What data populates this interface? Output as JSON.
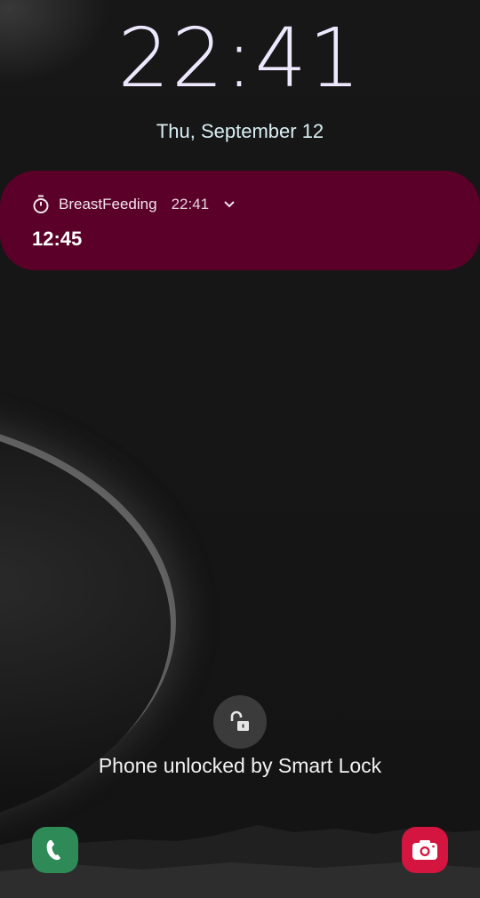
{
  "lockscreen": {
    "time": "22:41",
    "date": "Thu, September 12"
  },
  "notification": {
    "app_name": "BreastFeeding",
    "time": "22:41",
    "body": "12:45",
    "icon": "stopwatch-icon",
    "background_color": "#5a0029"
  },
  "lock": {
    "icon": "unlocked-padlock-icon",
    "status_text": "Phone unlocked by Smart Lock"
  },
  "shortcuts": {
    "left_icon": "phone-icon",
    "left_color": "#2e8b57",
    "right_icon": "camera-icon",
    "right_color": "#d3153f"
  }
}
